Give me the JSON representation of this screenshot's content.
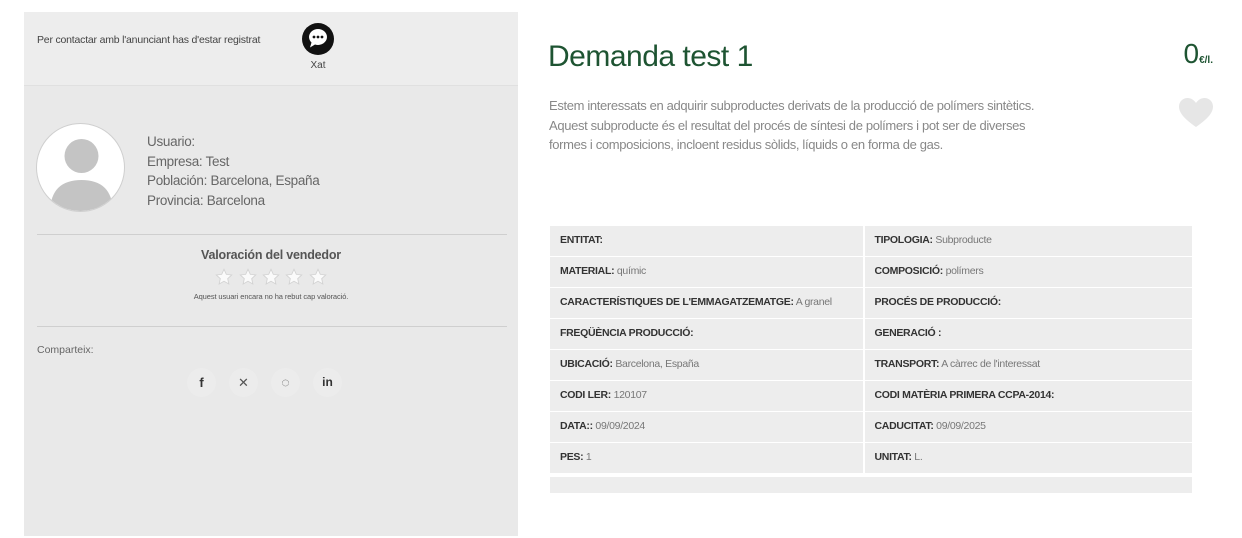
{
  "contact": {
    "message": "Per contactar amb l'anunciant has d'estar registrat",
    "chat_label": "Xat"
  },
  "seller": {
    "fields": [
      "Usuario:",
      "Empresa: Test",
      "Población: Barcelona, España",
      "Provincia: Barcelona"
    ]
  },
  "rating": {
    "title": "Valoración del vendedor",
    "stars_total": 5,
    "stars_filled": 0,
    "note": "Aquest usuari encara no ha rebut cap valoració."
  },
  "share": {
    "label": "Comparteix:",
    "networks": [
      {
        "name": "facebook",
        "glyph": "f"
      },
      {
        "name": "x",
        "glyph": "𝕏"
      },
      {
        "name": "whatsapp",
        "glyph": "✆"
      },
      {
        "name": "linkedin",
        "glyph": "in"
      }
    ]
  },
  "listing": {
    "title": "Demanda test 1",
    "price_value": "0",
    "price_unit": "€/l.",
    "description": "Estem interessats en adquirir subproductes derivats de la producció de polímers sintètics. Aquest subproducte és el resultat del procés de síntesi de polímers i pot ser de diverses formes i composicions, incloent residus sòlids, líquids o en forma de gas."
  },
  "specs": [
    [
      {
        "label": "ENTITAT:",
        "value": ""
      },
      {
        "label": "TIPOLOGIA:",
        "value": " Subproducte"
      }
    ],
    [
      {
        "label": "MATERIAL:",
        "value": " químic"
      },
      {
        "label": "COMPOSICIÓ:",
        "value": " polímers"
      }
    ],
    [
      {
        "label": "CARACTERÍSTIQUES DE L'EMMAGATZEMATGE:",
        "value": " A granel"
      },
      {
        "label": "PROCÉS DE PRODUCCIÓ:",
        "value": ""
      }
    ],
    [
      {
        "label": "FREQÜÈNCIA PRODUCCIÓ:",
        "value": ""
      },
      {
        "label": "GENERACIÓ :",
        "value": ""
      }
    ],
    [
      {
        "label": "UBICACIÓ:",
        "value": " Barcelona, España"
      },
      {
        "label": "TRANSPORT:",
        "value": " A càrrec de l'interessat"
      }
    ],
    [
      {
        "label": "CODI LER:",
        "value": " 120107"
      },
      {
        "label": "CODI MATÈRIA PRIMERA CCPA-2014:",
        "value": ""
      }
    ],
    [
      {
        "label": "DATA::",
        "value": " 09/09/2024"
      },
      {
        "label": "CADUCITAT:",
        "value": " 09/09/2025"
      }
    ],
    [
      {
        "label": "PES:",
        "value": " 1"
      },
      {
        "label": "UNITAT:",
        "value": " L."
      }
    ]
  ],
  "colors": {
    "brand_green": "#1e5432",
    "panel_grey": "#e9e9e9",
    "cell_grey": "#ededed"
  }
}
